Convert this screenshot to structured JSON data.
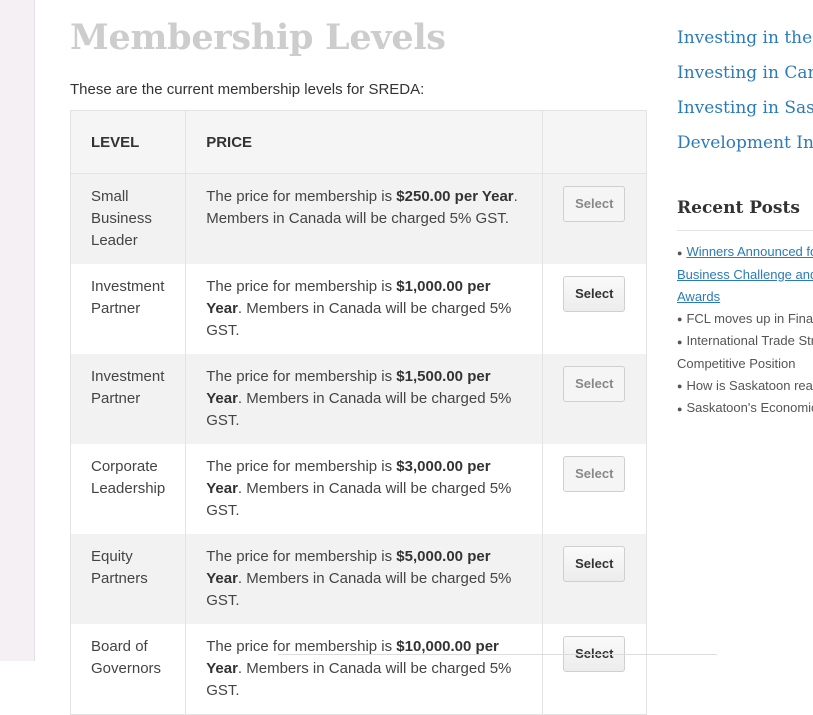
{
  "page": {
    "title": "Membership Levels",
    "intro": "These are the current membership levels for SREDA:"
  },
  "table": {
    "headers": {
      "level": "LEVEL",
      "price": "PRICE"
    },
    "price_prefix": "The price for membership is ",
    "price_suffix": ". Members in Canada will be charged 5% GST.",
    "rows": [
      {
        "level": "Small Business Leader",
        "price": "$250.00 per Year",
        "button": "Select",
        "button_state": "faded"
      },
      {
        "level": "Investment Partner",
        "price": "$1,000.00 per Year",
        "button": "Select",
        "button_state": "normal"
      },
      {
        "level": "Investment Partner",
        "price": "$1,500.00 per Year",
        "button": "Select",
        "button_state": "faded"
      },
      {
        "level": "Corporate Leadership",
        "price": "$3,000.00 per Year",
        "button": "Select",
        "button_state": "faded"
      },
      {
        "level": "Equity Partners",
        "price": "$5,000.00 per Year",
        "button": "Select",
        "button_state": "normal"
      },
      {
        "level": "Board of Governors",
        "price": "$10,000.00 per Year",
        "button": "Select",
        "button_state": "normal"
      }
    ]
  },
  "sidebar": {
    "links": [
      "Investing in the Saskatoon Region",
      "Investing in Canada",
      "Investing in Saskatoon",
      "Development Incentives"
    ],
    "recent_title": "Recent Posts",
    "recent_posts": [
      {
        "text": "Winners Announced for",
        "link": true,
        "bullet": true
      },
      {
        "text": "Business Challenge and",
        "link": true,
        "bullet": false
      },
      {
        "text": "Awards",
        "link": true,
        "bullet": false
      },
      {
        "text": "FCL moves up in Financial",
        "link": false,
        "bullet": true
      },
      {
        "text": "International Trade Strategy",
        "link": false,
        "bullet": true
      },
      {
        "text": "Competitive Position",
        "link": false,
        "bullet": false
      },
      {
        "text": "How is Saskatoon ready",
        "link": false,
        "bullet": true
      },
      {
        "text": "Saskatoon's Economic",
        "link": false,
        "bullet": true
      }
    ]
  },
  "colors": {
    "title": "#cdcdcd",
    "link": "#2b7bb9",
    "row_shade": "#f2f2f2"
  }
}
